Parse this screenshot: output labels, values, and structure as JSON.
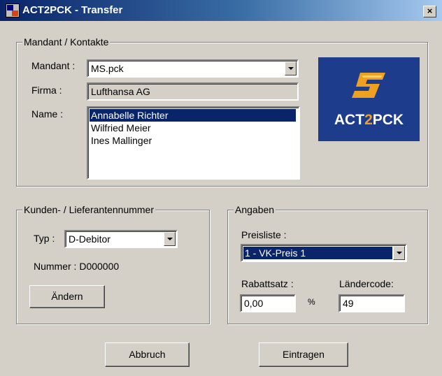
{
  "window": {
    "title": "ACT2PCK - Transfer",
    "close_glyph": "×"
  },
  "mandant_group": {
    "legend": "Mandant / Kontakte",
    "mandant_label": "Mandant :",
    "mandant_value": "MS.pck",
    "firma_label": "Firma :",
    "firma_value": "Lufthansa AG",
    "name_label": "Name :",
    "names": [
      "Annabelle Richter",
      "Wilfried Meier",
      "Ines Mallinger"
    ],
    "selected_name_index": 0
  },
  "logo": {
    "text_main": "ACT",
    "text_accent": "2",
    "text_end": "PCK",
    "bg_color": "#1e3c8c",
    "accent_color": "#f0a020"
  },
  "kunden_group": {
    "legend": "Kunden- / Lieferantennummer",
    "typ_label": "Typ :",
    "typ_value": "D-Debitor",
    "nummer_text": "Nummer : D000000",
    "aendern_label": "Ändern"
  },
  "angaben_group": {
    "legend": "Angaben",
    "preisliste_label": "Preisliste :",
    "preisliste_value": "1 - VK-Preis 1",
    "rabattsatz_label": "Rabattsatz :",
    "rabattsatz_value": "0,00",
    "percent_sign": "%",
    "laendercode_label": "Ländercode:",
    "laendercode_value": "49"
  },
  "buttons": {
    "cancel_label": "Abbruch",
    "submit_label": "Eintragen"
  }
}
